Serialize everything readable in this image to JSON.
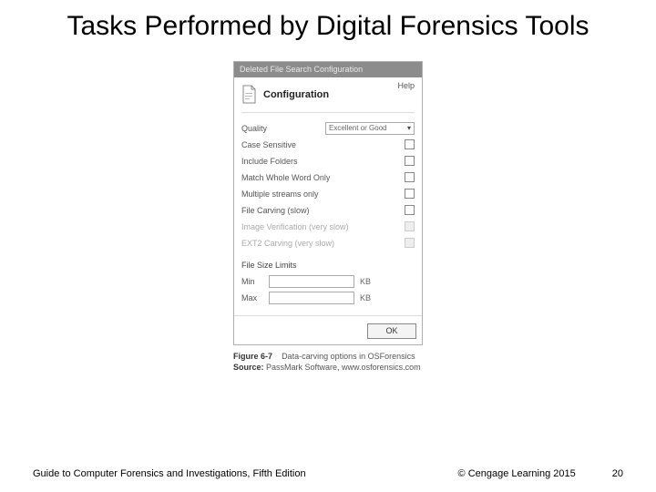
{
  "title": "Tasks Performed by Digital Forensics Tools",
  "dialog": {
    "titlebar": "Deleted File Search Configuration",
    "help": "Help",
    "header": "Configuration",
    "quality_label": "Quality",
    "quality_value": "Excellent or Good",
    "options": {
      "case_sensitive": "Case Sensitive",
      "include_folders": "Include Folders",
      "match_whole_word": "Match Whole Word Only",
      "multiple_streams": "Multiple streams only",
      "file_carving": "File Carving (slow)",
      "image_verify": "Image Verification (very slow)",
      "ext2_carving": "EXT2 Carving (very slow)"
    },
    "size_limits_label": "File Size Limits",
    "min_label": "Min",
    "max_label": "Max",
    "unit": "KB",
    "ok": "OK"
  },
  "caption": {
    "fig_label": "Figure 6-7",
    "fig_text": "Data-carving options in OSForensics",
    "src_label": "Source:",
    "src_text": "PassMark Software, www.osforensics.com"
  },
  "footer": {
    "left": "Guide to Computer Forensics and Investigations, Fifth Edition",
    "mid": "© Cengage Learning  2015",
    "page": "20"
  }
}
